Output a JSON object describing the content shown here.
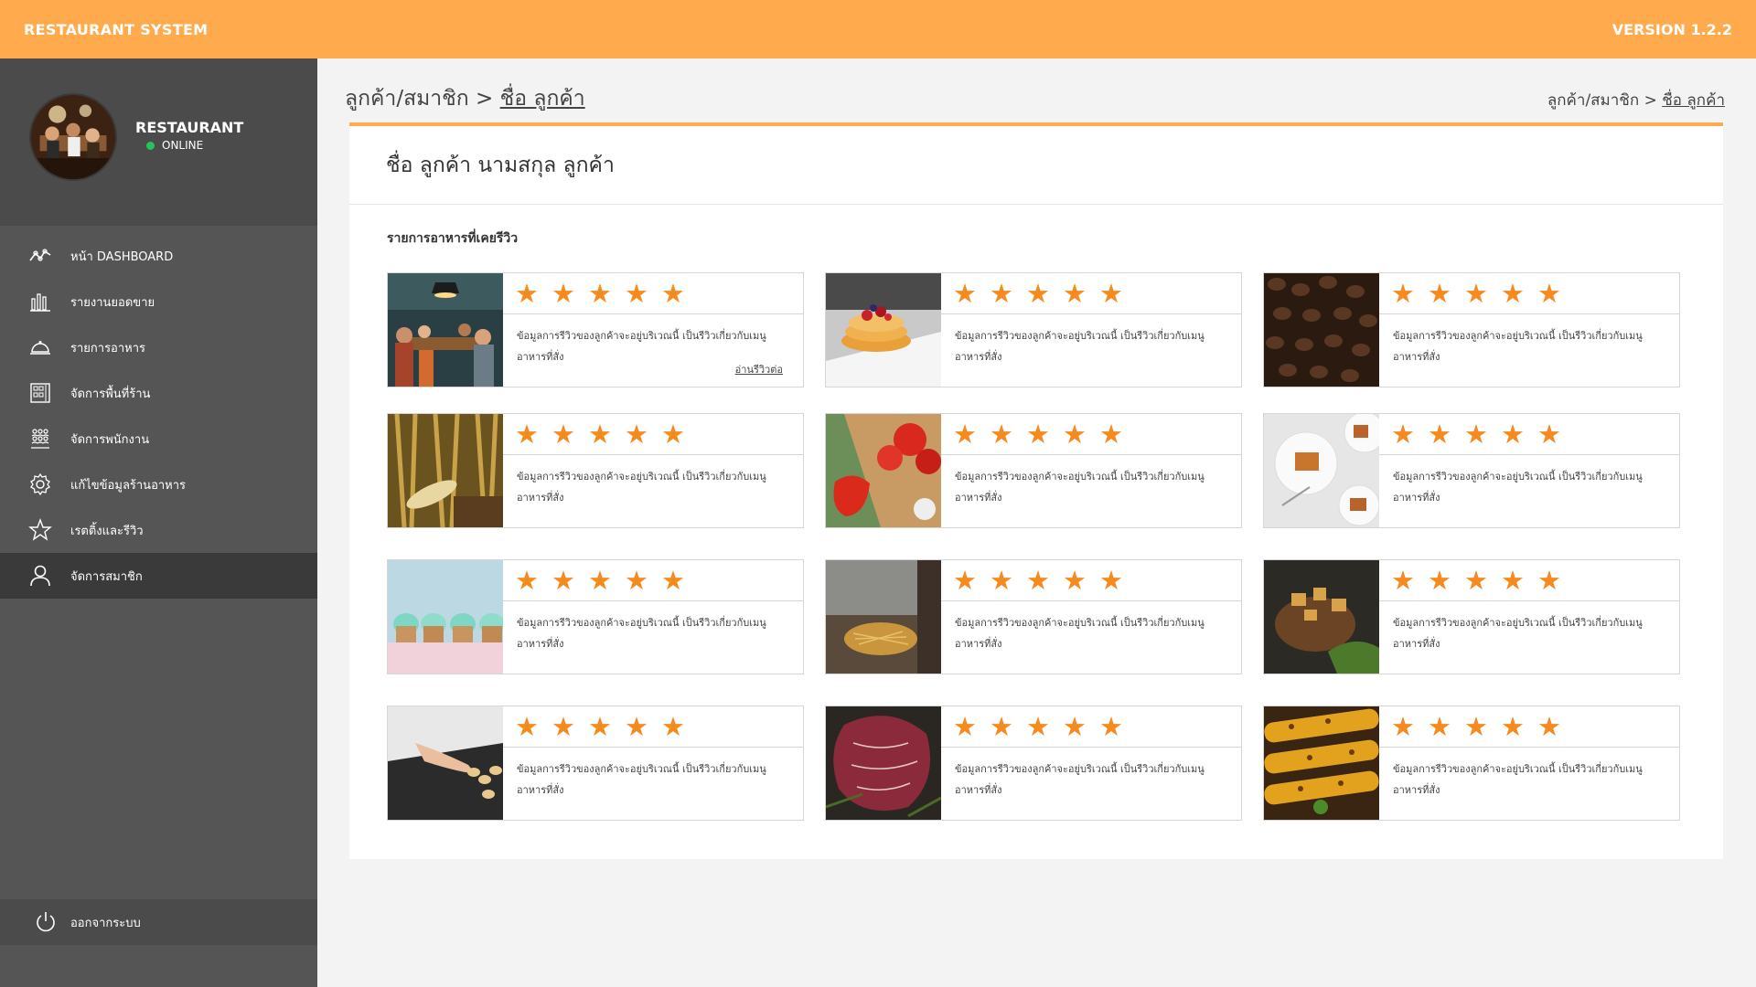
{
  "app": {
    "title": "RESTAURANT SYSTEM",
    "version": "VERSION 1.2.2"
  },
  "profile": {
    "name": "RESTAURANT",
    "status": "ONLINE",
    "status_color": "#23c45b"
  },
  "colors": {
    "accent": "#ffaa4c",
    "star": "#f58a1e",
    "sidebar": "#555555",
    "active": "#3a3a3a"
  },
  "menu": [
    {
      "label": "หน้า DASHBOARD",
      "icon": "dashboard-line-icon"
    },
    {
      "label": "รายงานยอดขาย",
      "icon": "bar-chart-icon"
    },
    {
      "label": "รายการอาหาร",
      "icon": "food-cloche-icon"
    },
    {
      "label": "จัดการพื้นที่ร้าน",
      "icon": "floor-plan-icon"
    },
    {
      "label": "จัดการพนักงาน",
      "icon": "staff-group-icon"
    },
    {
      "label": "แก้ไขข้อมูลร้านอาหาร",
      "icon": "gear-icon"
    },
    {
      "label": "เรตติ้งและรีวิว",
      "icon": "star-icon"
    },
    {
      "label": "จัดการสมาชิก",
      "icon": "user-icon",
      "active": true
    }
  ],
  "logout": {
    "label": "ออกจากระบบ",
    "icon": "power-icon"
  },
  "breadcrumb": {
    "parent": "ลูกค้า/สมาชิก",
    "separator": ">",
    "current": "ชื่อ ลูกค้า"
  },
  "customer": {
    "full_name": "ชื่อ ลูกค้า นามสกุล ลูกค้า"
  },
  "reviews_section": {
    "title": "รายการอาหารที่เคยรีวิว"
  },
  "reviews": [
    {
      "photo": "restaurant-interior",
      "rating": 5,
      "text": "ข้อมูลการรีวิวของลูกค้าจะอยู่บริเวณนี้ เป็นรีวิวเกี่ยวกับเมนูอาหารที่สั่ง",
      "more": "อ่านรีวิวต่อ"
    },
    {
      "photo": "pancakes",
      "rating": 5,
      "text": "ข้อมูลการรีวิวของลูกค้าจะอยู่บริเวณนี้ เป็นรีวิวเกี่ยวกับเมนูอาหารที่สั่ง"
    },
    {
      "photo": "coffee-beans",
      "rating": 5,
      "text": "ข้อมูลการรีวิวของลูกค้าจะอยู่บริเวณนี้ เป็นรีวิวเกี่ยวกับเมนูอาหารที่สั่ง"
    },
    {
      "photo": "corn-field",
      "rating": 5,
      "text": "ข้อมูลการรีวิวของลูกค้าจะอยู่บริเวณนี้ เป็นรีวิวเกี่ยวกับเมนูอาหารที่สั่ง"
    },
    {
      "photo": "tomatoes",
      "rating": 5,
      "text": "ข้อมูลการรีวิวของลูกค้าจะอยู่บริเวณนี้ เป็นรีวิวเกี่ยวกับเมนูอาหารที่สั่ง"
    },
    {
      "photo": "dessert-plates",
      "rating": 5,
      "text": "ข้อมูลการรีวิวของลูกค้าจะอยู่บริเวณนี้ เป็นรีวิวเกี่ยวกับเมนูอาหารที่สั่ง"
    },
    {
      "photo": "cupcakes",
      "rating": 5,
      "text": "ข้อมูลการรีวิวของลูกค้าจะอยู่บริเวณนี้ เป็นรีวิวเกี่ยวกับเมนูอาหารที่สั่ง"
    },
    {
      "photo": "noodles-cooking",
      "rating": 5,
      "text": "ข้อมูลการรีวิวของลูกค้าจะอยู่บริเวณนี้ เป็นรีวิวเกี่ยวกับเมนูอาหารที่สั่ง"
    },
    {
      "photo": "meat-dish",
      "rating": 5,
      "text": "ข้อมูลการรีวิวของลูกค้าจะอยู่บริเวณนี้ เป็นรีวิวเกี่ยวกับเมนูอาหารที่สั่ง"
    },
    {
      "photo": "baking-tray",
      "rating": 5,
      "text": "ข้อมูลการรีวิวของลูกค้าจะอยู่บริเวณนี้ เป็นรีวิวเกี่ยวกับเมนูอาหารที่สั่ง"
    },
    {
      "photo": "raw-steak",
      "rating": 5,
      "text": "ข้อมูลการรีวิวของลูกค้าจะอยู่บริเวณนี้ เป็นรีวิวเกี่ยวกับเมนูอาหารที่สั่ง"
    },
    {
      "photo": "grilled-corn",
      "rating": 5,
      "text": "ข้อมูลการรีวิวของลูกค้าจะอยู่บริเวณนี้ เป็นรีวิวเกี่ยวกับเมนูอาหารที่สั่ง"
    }
  ]
}
